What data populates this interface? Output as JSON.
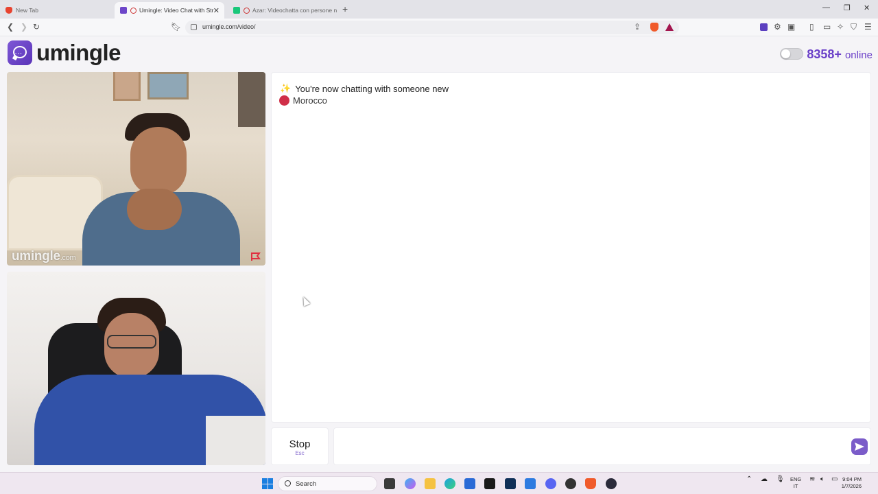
{
  "browser": {
    "tabs": [
      {
        "label": "New Tab",
        "active": false
      },
      {
        "label": "Umingle: Video Chat with Str",
        "active": true
      },
      {
        "label": "Azar: Videochatta con persone n",
        "active": false
      }
    ],
    "url": "umingle.com/video/"
  },
  "header": {
    "brand": "umingle",
    "online_count": "8358+",
    "online_label": "online"
  },
  "video": {
    "watermark_main": "umingle",
    "watermark_domain": ".com"
  },
  "chat": {
    "status_message": "You're now chatting with someone new",
    "country": "Morocco",
    "country_color": "#d02f48"
  },
  "controls": {
    "stop_label": "Stop",
    "stop_shortcut": "Esc",
    "message_value": "",
    "accent": "#7b5cc9"
  },
  "taskbar": {
    "search_label": "Search",
    "lang_top": "ENG",
    "lang_bottom": "IT",
    "time": "9:04 PM",
    "date": "1/7/2026"
  },
  "icons": [
    "back-icon",
    "forward-icon",
    "reload-icon",
    "bookmark-icon",
    "share-icon",
    "brave-shield-icon",
    "rewards-icon",
    "extension-icon",
    "sidebar-icon",
    "wallet-icon",
    "leo-icon",
    "vpn-icon",
    "menu-icon",
    "send-icon",
    "windows-start-icon",
    "search-icon"
  ]
}
